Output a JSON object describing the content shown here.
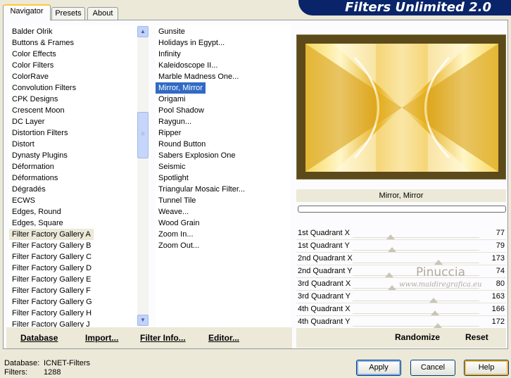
{
  "tabs": [
    "Navigator",
    "Presets",
    "About"
  ],
  "banner_title": "Filters Unlimited 2.0",
  "categories": [
    "Balder Olrik",
    "Buttons & Frames",
    "Color Effects",
    "Color Filters",
    "ColorRave",
    "Convolution Filters",
    "CPK Designs",
    "Crescent Moon",
    "DC Layer",
    "Distortion Filters",
    "Distort",
    "Dynasty Plugins",
    "Déformation",
    "Déformations",
    "Dégradés",
    "ECWS",
    "Edges, Round",
    "Edges, Square",
    "Filter Factory Gallery A",
    "Filter Factory Gallery B",
    "Filter Factory Gallery C",
    "Filter Factory Gallery D",
    "Filter Factory Gallery E",
    "Filter Factory Gallery F",
    "Filter Factory Gallery G",
    "Filter Factory Gallery H",
    "Filter Factory Gallery J"
  ],
  "selected_category_index": 18,
  "filters": [
    "Gunsite",
    "Holidays in Egypt...",
    "Infinity",
    "Kaleidoscope II...",
    "Marble Madness One...",
    "Mirror, Mirror",
    "Origami",
    "Pool Shadow",
    "Raygun...",
    "Ripper",
    "Round Button",
    "Sabers Explosion One",
    "Seismic",
    "Spotlight",
    "Triangular Mosaic Filter...",
    "Tunnel Tile",
    "Weave...",
    "Wood Grain",
    "Zoom In...",
    "Zoom Out..."
  ],
  "selected_filter_index": 5,
  "bottom_buttons": {
    "database": "Database",
    "import": "Import...",
    "filter_info": "Filter Info...",
    "editor": "Editor..."
  },
  "preview_filter_name": "Mirror, Mirror",
  "params": [
    {
      "label": "1st Quadrant X",
      "value": "77",
      "level": 0.3
    },
    {
      "label": "1st Quadrant Y",
      "value": "79",
      "level": 0.31
    },
    {
      "label": "2nd Quadrant X",
      "value": "173",
      "level": 0.68
    },
    {
      "label": "2nd Quadrant Y",
      "value": "74",
      "level": 0.29
    },
    {
      "label": "3rd Quadrant X",
      "value": "80",
      "level": 0.31
    },
    {
      "label": "3rd Quadrant Y",
      "value": "163",
      "level": 0.64
    },
    {
      "label": "4th Quadrant X",
      "value": "166",
      "level": 0.65
    },
    {
      "label": "4th Quadrant Y",
      "value": "172",
      "level": 0.67
    }
  ],
  "watermark": {
    "line1": "Pinuccia",
    "line2": "www.maidiregrafica.eu"
  },
  "randomize": "Randomize",
  "reset": "Reset",
  "status": {
    "database_label": "Database:",
    "database_value": "ICNET-Filters",
    "filters_label": "Filters:",
    "filters_value": "1288"
  },
  "dialog": {
    "apply": "Apply",
    "cancel": "Cancel",
    "help": "Help"
  }
}
